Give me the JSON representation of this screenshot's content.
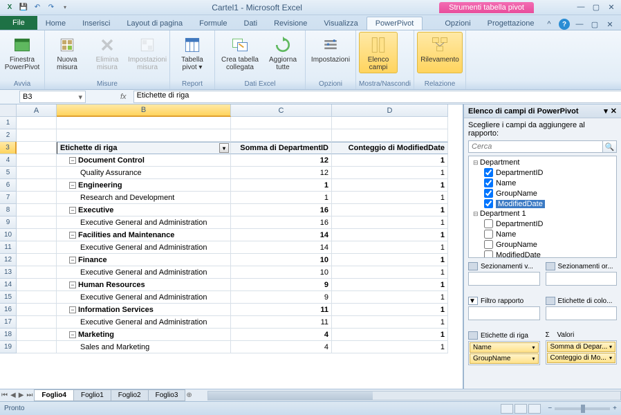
{
  "titlebar": {
    "title": "Cartel1 - Microsoft Excel",
    "contextual": "Strumenti tabella pivot"
  },
  "tabs": {
    "file": "File",
    "items": [
      "Home",
      "Inserisci",
      "Layout di pagina",
      "Formule",
      "Dati",
      "Revisione",
      "Visualizza",
      "PowerPivot"
    ],
    "context_items": [
      "Opzioni",
      "Progettazione"
    ]
  },
  "ribbon": {
    "groups": {
      "avvia": {
        "label": "Avvia",
        "btn1_l1": "Finestra",
        "btn1_l2": "PowerPivot"
      },
      "misure": {
        "label": "Misure",
        "btn1_l1": "Nuova",
        "btn1_l2": "misura",
        "btn2_l1": "Elimina",
        "btn2_l2": "misura",
        "btn3_l1": "Impostazioni",
        "btn3_l2": "misura"
      },
      "report": {
        "label": "Report",
        "btn1_l1": "Tabella",
        "btn1_l2": "pivot ▾"
      },
      "datiexcel": {
        "label": "Dati Excel",
        "btn1_l1": "Crea tabella",
        "btn1_l2": "collegata",
        "btn2_l1": "Aggiorna",
        "btn2_l2": "tutte"
      },
      "opzioni": {
        "label": "Opzioni",
        "btn1_l1": "Impostazioni",
        "btn1_l2": ""
      },
      "mostra": {
        "label": "Mostra/Nascondi",
        "btn1_l1": "Elenco",
        "btn1_l2": "campi"
      },
      "relazione": {
        "label": "Relazione",
        "btn1_l1": "Rilevamento",
        "btn1_l2": ""
      }
    }
  },
  "formula": {
    "name": "B3",
    "value": "Etichette di riga"
  },
  "columns": [
    "A",
    "B",
    "C",
    "D"
  ],
  "pivot_headers": {
    "b": "Etichette di riga",
    "c": "Somma di DepartmentID",
    "d": "Conteggio di ModifiedDate"
  },
  "pivot_rows": [
    {
      "r": 4,
      "label": "Document Control",
      "type": "group",
      "c": "12",
      "d": "1"
    },
    {
      "r": 5,
      "label": "Quality Assurance",
      "type": "detail",
      "c": "12",
      "d": "1"
    },
    {
      "r": 6,
      "label": "Engineering",
      "type": "group",
      "c": "1",
      "d": "1"
    },
    {
      "r": 7,
      "label": "Research and Development",
      "type": "detail",
      "c": "1",
      "d": "1"
    },
    {
      "r": 8,
      "label": "Executive",
      "type": "group",
      "c": "16",
      "d": "1"
    },
    {
      "r": 9,
      "label": "Executive General and Administration",
      "type": "detail",
      "c": "16",
      "d": "1"
    },
    {
      "r": 10,
      "label": "Facilities and Maintenance",
      "type": "group",
      "c": "14",
      "d": "1"
    },
    {
      "r": 11,
      "label": "Executive General and Administration",
      "type": "detail",
      "c": "14",
      "d": "1"
    },
    {
      "r": 12,
      "label": "Finance",
      "type": "group",
      "c": "10",
      "d": "1"
    },
    {
      "r": 13,
      "label": "Executive General and Administration",
      "type": "detail",
      "c": "10",
      "d": "1"
    },
    {
      "r": 14,
      "label": "Human Resources",
      "type": "group",
      "c": "9",
      "d": "1"
    },
    {
      "r": 15,
      "label": "Executive General and Administration",
      "type": "detail",
      "c": "9",
      "d": "1"
    },
    {
      "r": 16,
      "label": "Information Services",
      "type": "group",
      "c": "11",
      "d": "1"
    },
    {
      "r": 17,
      "label": "Executive General and Administration",
      "type": "detail",
      "c": "11",
      "d": "1"
    },
    {
      "r": 18,
      "label": "Marketing",
      "type": "group",
      "c": "4",
      "d": "1"
    },
    {
      "r": 19,
      "label": "Sales and Marketing",
      "type": "detail",
      "c": "4",
      "d": "1"
    }
  ],
  "fieldlist": {
    "title": "Elenco di campi di PowerPivot",
    "subtitle": "Scegliere i campi da aggiungere al rapporto:",
    "search_placeholder": "Cerca",
    "tables": [
      {
        "name": "Department",
        "fields": [
          {
            "name": "DepartmentID",
            "checked": true
          },
          {
            "name": "Name",
            "checked": true
          },
          {
            "name": "GroupName",
            "checked": true
          },
          {
            "name": "ModifiedDate",
            "checked": true,
            "selected": true
          }
        ]
      },
      {
        "name": "Department 1",
        "fields": [
          {
            "name": "DepartmentID",
            "checked": false
          },
          {
            "name": "Name",
            "checked": false
          },
          {
            "name": "GroupName",
            "checked": false
          },
          {
            "name": "ModifiedDate",
            "checked": false
          }
        ]
      }
    ],
    "areas": {
      "slicer_v": "Sezionamenti v...",
      "slicer_h": "Sezionamenti or...",
      "filter": "Filtro rapporto",
      "cols": "Etichette di colo...",
      "rows": "Etichette di riga",
      "vals": "Valori",
      "row_items": [
        "Name",
        "GroupName"
      ],
      "val_items": [
        "Somma di Depar...",
        "Conteggio di Mo..."
      ]
    }
  },
  "sheets": {
    "active": "Foglio4",
    "others": [
      "Foglio1",
      "Foglio2",
      "Foglio3"
    ]
  },
  "status": {
    "ready": "Pronto"
  }
}
